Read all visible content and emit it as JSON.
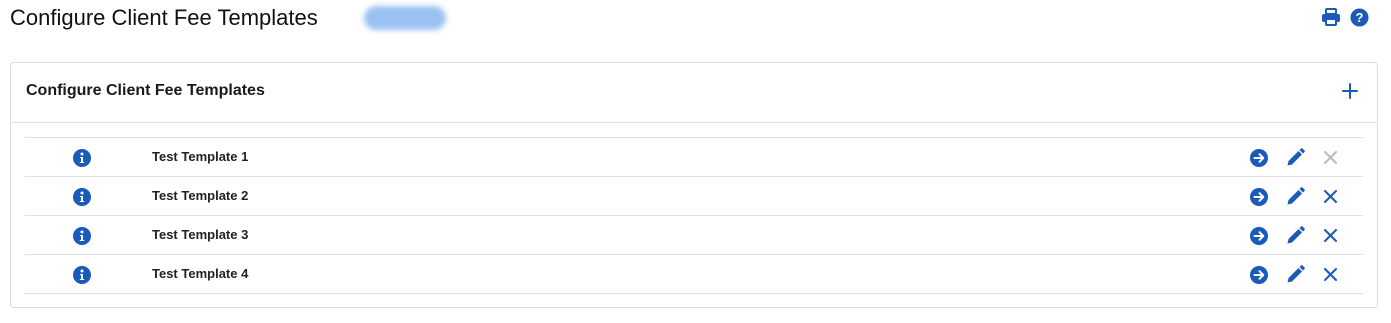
{
  "header": {
    "title": "Configure Client Fee Templates",
    "status_badge": "",
    "icons": [
      "print-icon",
      "help-icon"
    ]
  },
  "card": {
    "title": "Configure Client Fee Templates",
    "add_icon": "plus-icon"
  },
  "templates": [
    {
      "name": "Test Template 1",
      "delete_enabled": false
    },
    {
      "name": "Test Template 2",
      "delete_enabled": true
    },
    {
      "name": "Test Template 3",
      "delete_enabled": true
    },
    {
      "name": "Test Template 4",
      "delete_enabled": true
    }
  ],
  "row_icons": [
    "info-icon",
    "arrow-right-circle-icon",
    "pencil-icon",
    "close-icon"
  ],
  "colors": {
    "accent": "#1a5ab8",
    "disabled": "#b8bbc0",
    "border": "#dfe1e4"
  }
}
